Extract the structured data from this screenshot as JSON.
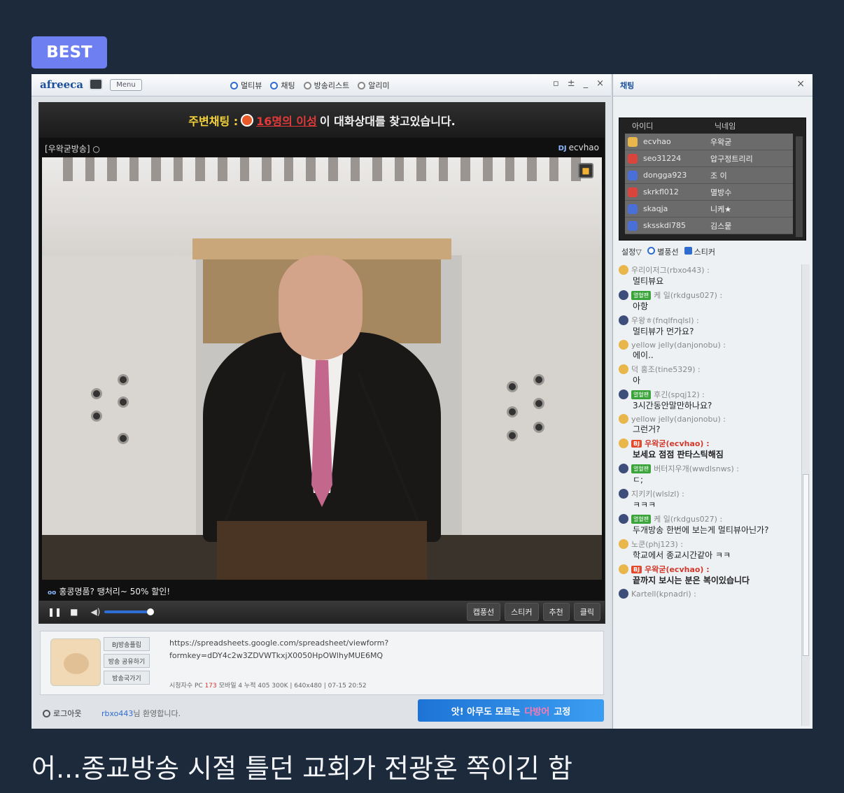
{
  "badge": "BEST",
  "caption": "어...종교방송 시절 틀던 교회가 전광훈 쪽이긴 함",
  "player": {
    "logo": "afreeca",
    "menu": "Menu",
    "nav": [
      "멀티뷰",
      "채팅",
      "방송리스트",
      "알리미"
    ],
    "win_ctrls": [
      "▫",
      "±",
      "_",
      "×"
    ],
    "banner_prefix": "주변채팅 :",
    "banner_red": "16명의 이성",
    "banner_suffix": "이 대화상대를 찾고있습니다.",
    "channel": "[우왁굳방송] ○",
    "dj_label": "DJ",
    "dj_name": "ecvhao",
    "ticker_label": "oo",
    "ticker": "홍콩명품? 땡처리~ 50% 할인!",
    "ctrl_buttons": [
      "캡풍선",
      "스티커",
      "추천",
      "클릭"
    ],
    "side_buttons": [
      "BJ방송플립",
      "방송 공유하기",
      "방송국가기"
    ],
    "url_line1": "https://spreadsheets.google.com/spreadsheet/viewform?",
    "url_line2": "formkey=dDY4c2w3ZDVWTkxjX0050HpOWlhyMUE6MQ",
    "stats_prefix": "시청자수 PC",
    "stats_pc": "173",
    "stats_rest": "모바일 4   누적 405   300K | 640x480 | 07-15 20:52",
    "logout": "로그아웃",
    "welcome_uid": "rbxo443",
    "welcome_text": "님 환영합니다.",
    "ad_prefix": "앗! 아무도 모르는",
    "ad_pink": "다방어",
    "ad_suffix": "고정"
  },
  "chat": {
    "title": "채팅",
    "close": "×",
    "list_head": [
      "아이디",
      "닉네임"
    ],
    "users": [
      {
        "id": "ecvhao",
        "nick": "우왁굳",
        "icon": "gold"
      },
      {
        "id": "seo31224",
        "nick": "압구정트리리",
        "icon": "red"
      },
      {
        "id": "dongga923",
        "nick": "조 이",
        "icon": "blue"
      },
      {
        "id": "skrkfl012",
        "nick": "멸방수",
        "icon": "red"
      },
      {
        "id": "skaqja",
        "nick": "니케★",
        "icon": "blue"
      },
      {
        "id": "sksskdi785",
        "nick": "김스뭍",
        "icon": "blue"
      }
    ],
    "tabs": [
      "설정▽",
      "별풍선",
      "스티커"
    ],
    "messages": [
      {
        "who": "우리이저그(rbxo443) :",
        "text": "멀티뷰요",
        "tag": "",
        "bold": false
      },
      {
        "who": "케 일(rkdgus027) :",
        "text": "아항",
        "tag": "열혈팬",
        "bold": false
      },
      {
        "who": "우왕ㅎ(fnqlfnqlsl) :",
        "text": "멀티뷰가 먼가요?",
        "tag": "",
        "bold": false
      },
      {
        "who": "yellow jelly(danjonobu) :",
        "text": "에이..",
        "tag": "",
        "bold": false
      },
      {
        "who": "덕 홍조(tine5329) :",
        "text": "아",
        "tag": "",
        "bold": false
      },
      {
        "who": "후긴(spqj12) :",
        "text": "3시간동안말만하나요?",
        "tag": "열혈팬",
        "bold": false
      },
      {
        "who": "yellow jelly(danjonobu) :",
        "text": "그런거?",
        "tag": "",
        "bold": false
      },
      {
        "who": "우왁굳(ecvhao) :",
        "text": "보세요 점점 판타스틱해짐",
        "tag": "BJ",
        "bold": true
      },
      {
        "who": "버터지우개(wwdlsnws) :",
        "text": "ㄷ;",
        "tag": "열혈팬",
        "bold": false
      },
      {
        "who": "지키키(wlslzl) :",
        "text": "ㅋㅋㅋ",
        "tag": "",
        "bold": false
      },
      {
        "who": "케 일(rkdgus027) :",
        "text": "두개방송 한번에 보는게 멀티뷰아닌가?",
        "tag": "열혈팬",
        "bold": false
      },
      {
        "who": "노쿤(phj123) :",
        "text": "학교에서 종교시간같아 ㅋㅋ",
        "tag": "",
        "bold": false
      },
      {
        "who": "우왁굳(ecvhao) :",
        "text": "끝까지 보시는 분은 복이있습니다",
        "tag": "BJ",
        "bold": true
      },
      {
        "who": "Kartell(kpnadri) :",
        "text": "",
        "tag": "",
        "bold": false
      }
    ]
  }
}
